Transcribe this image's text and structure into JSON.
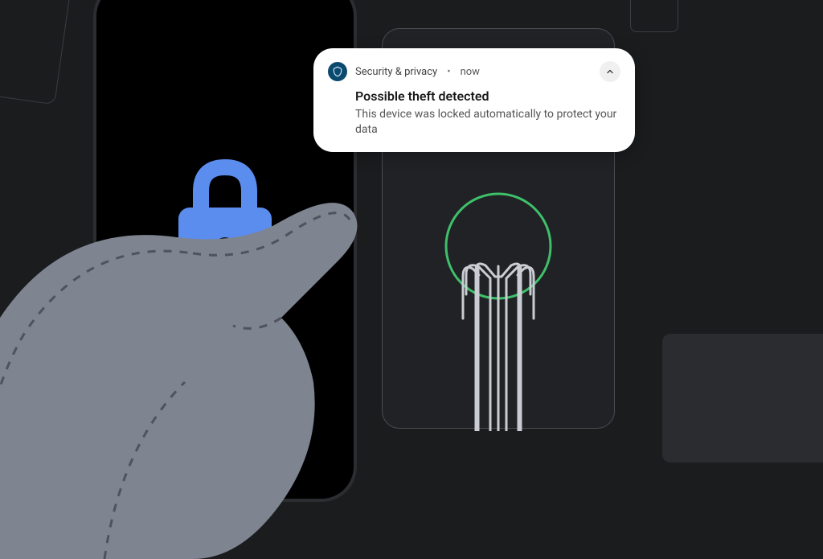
{
  "notification": {
    "app_name": "Security & privacy",
    "separator": "•",
    "time": "now",
    "title": "Possible theft detected",
    "body": "This device was locked automatically to protect your data"
  },
  "icons": {
    "shield": "shield-icon",
    "lock": "lock-icon",
    "chevron_up": "chevron-up-icon"
  },
  "colors": {
    "lock": "#5b8def",
    "notif_icon_bg": "#0b4a6f",
    "figure_ring": "#3fbf6a"
  }
}
